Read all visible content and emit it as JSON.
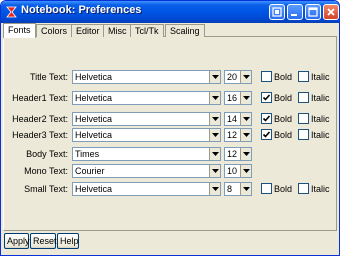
{
  "window": {
    "title": "Notebook: Preferences",
    "app_icon": "notebook-app-icon",
    "controls": [
      "restore-icon",
      "minimize-icon",
      "maximize-icon",
      "close-icon"
    ]
  },
  "tabs": [
    {
      "label": "Fonts",
      "active": true
    },
    {
      "label": "Colors",
      "active": false
    },
    {
      "label": "Editor",
      "active": false
    },
    {
      "label": "Misc",
      "active": false
    },
    {
      "label": "Tcl/Tk",
      "active": false
    },
    {
      "label": "Scaling",
      "active": false
    }
  ],
  "fonts": [
    {
      "label": "Title Text:",
      "font": "Helvetica",
      "size": "20",
      "bold": false,
      "italic": false,
      "has_style": true
    },
    {
      "label": "Header1 Text:",
      "font": "Helvetica",
      "size": "16",
      "bold": true,
      "italic": false,
      "has_style": true
    },
    {
      "label": "Header2 Text:",
      "font": "Helvetica",
      "size": "14",
      "bold": true,
      "italic": false,
      "has_style": true
    },
    {
      "label": "Header3 Text:",
      "font": "Helvetica",
      "size": "12",
      "bold": true,
      "italic": false,
      "has_style": true
    },
    {
      "label": "Body Text:",
      "font": "Times",
      "size": "12",
      "bold": false,
      "italic": false,
      "has_style": false
    },
    {
      "label": "Mono Text:",
      "font": "Courier",
      "size": "10",
      "bold": false,
      "italic": false,
      "has_style": false
    },
    {
      "label": "Small Text:",
      "font": "Helvetica",
      "size": "8",
      "bold": false,
      "italic": false,
      "has_style": true
    }
  ],
  "style_labels": {
    "bold": "Bold",
    "italic": "Italic"
  },
  "buttons": {
    "apply": "Apply",
    "reset": "Reset",
    "help": "Help"
  }
}
